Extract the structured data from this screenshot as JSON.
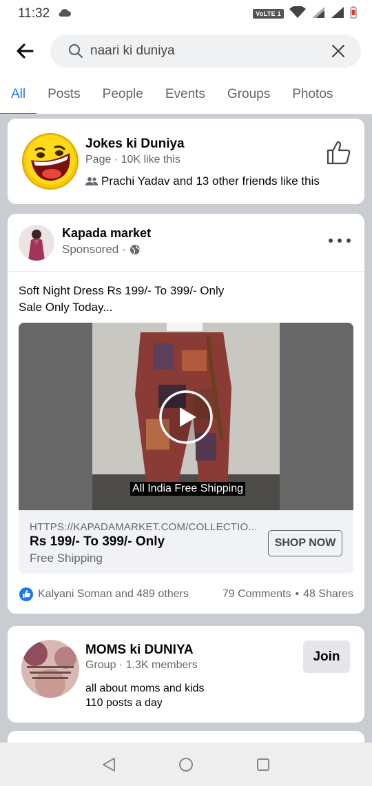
{
  "status_bar": {
    "time": "11:32",
    "network_badge": "VoLTE 1",
    "icons": [
      "cloud-upload-icon",
      "wifi-icon",
      "signal-r-icon",
      "signal-x-icon",
      "battery-low-icon"
    ]
  },
  "search": {
    "value": "naari ki duniya",
    "back_icon": "arrow-left-icon",
    "search_icon": "search-icon",
    "clear_icon": "close-icon"
  },
  "tabs": [
    {
      "label": "All",
      "active": true
    },
    {
      "label": "Posts",
      "active": false
    },
    {
      "label": "People",
      "active": false
    },
    {
      "label": "Events",
      "active": false
    },
    {
      "label": "Groups",
      "active": false
    },
    {
      "label": "Photos",
      "active": false
    }
  ],
  "page_result": {
    "name": "Jokes ki Duniya",
    "meta": "Page · 10K like this",
    "friends": "Prachi Yadav and 13 other friends like this",
    "action_icon": "thumbs-up-icon"
  },
  "ad_post": {
    "author": "Kapada market",
    "sponsored": "Sponsored ·",
    "privacy_icon": "globe-icon",
    "text_line1": "Soft Night Dress Rs 199/- To 399/- Only",
    "text_line2": "Sale Only Today...",
    "video_caption": "All India Free Shipping",
    "link": {
      "url": "HTTPS://KAPADAMARKET.COM/COLLECTIO...",
      "title": "Rs 199/- To 399/- Only",
      "subtitle": "Free Shipping",
      "cta": "SHOP NOW"
    },
    "reactions": "Kalyani Soman and 489 others",
    "comments": "79 Comments",
    "separator": "•",
    "shares": "48 Shares"
  },
  "group_result": {
    "name": "MOMS ki DUNIYA",
    "meta": "Group · 1.3K members",
    "desc1": "all about moms and kids",
    "desc2": "110 posts a day",
    "join_label": "Join"
  },
  "colors": {
    "accent": "#1877f2",
    "background": "#c9ccd1",
    "card": "#ffffff",
    "secondary_text": "#606770"
  }
}
